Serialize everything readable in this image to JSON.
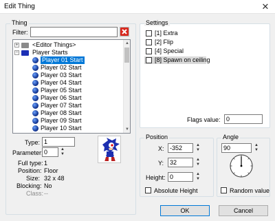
{
  "window": {
    "title": "Edit Thing",
    "close_glyph": "✕"
  },
  "thing": {
    "group_title": "Thing",
    "filter_label": "Filter:",
    "filter_value": "",
    "tree": {
      "editor_things": "<Editor Things>",
      "player_starts": "Player Starts",
      "items": [
        "Player 01 Start",
        "Player 02 Start",
        "Player 03 Start",
        "Player 04 Start",
        "Player 05 Start",
        "Player 06 Start",
        "Player 07 Start",
        "Player 08 Start",
        "Player 09 Start",
        "Player 10 Start",
        "Player 11 Start"
      ],
      "selected_index": 0
    },
    "type_label": "Type:",
    "type_value": "1",
    "parameter_label": "Parameter:",
    "parameter_value": "0",
    "full_type_label": "Full type:",
    "full_type_value": "1",
    "position_label": "Position:",
    "position_value": "Floor",
    "size_label": "Size:",
    "size_value": "32 x 48",
    "blocking_label": "Blocking:",
    "blocking_value": "No",
    "class_label": "Class:",
    "class_value": "--"
  },
  "settings": {
    "group_title": "Settings",
    "flags": [
      {
        "label": "[1] Extra",
        "checked": false
      },
      {
        "label": "[2] Flip",
        "checked": false
      },
      {
        "label": "[4] Special",
        "checked": false
      },
      {
        "label": "[8] Spawn on ceiling",
        "checked": false
      }
    ],
    "flags_value_label": "Flags value:",
    "flags_value": "0"
  },
  "position": {
    "group_title": "Position",
    "x_label": "X:",
    "x_value": "-352",
    "y_label": "Y:",
    "y_value": "32",
    "height_label": "Height:",
    "height_value": "0",
    "absolute_height_label": "Absolute Height",
    "absolute_height_checked": false
  },
  "angle": {
    "group_title": "Angle",
    "value": "90",
    "random_label": "Random value",
    "random_checked": false
  },
  "buttons": {
    "ok": "OK",
    "cancel": "Cancel"
  },
  "colors": {
    "selection": "#0078d7",
    "folder": "#1c2fb5"
  }
}
